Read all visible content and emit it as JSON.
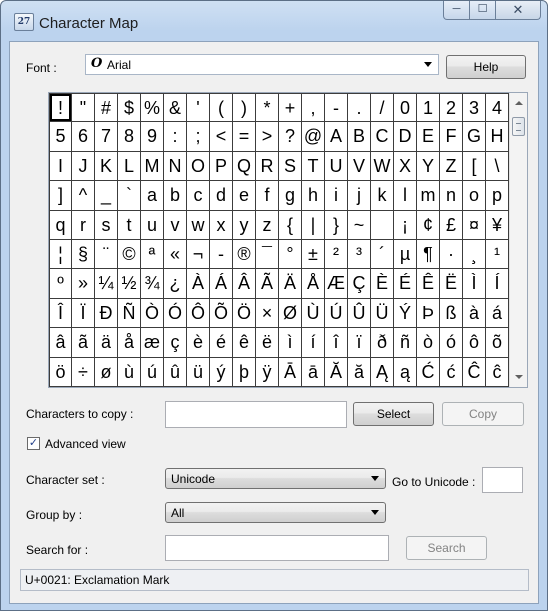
{
  "window": {
    "title": "Character Map",
    "app_icon_text": "27",
    "minimize_glyph": "─",
    "maximize_glyph": "☐",
    "close_glyph": "✕"
  },
  "font": {
    "label": "Font :",
    "icon_glyph": "O",
    "selected": "Arial",
    "help_label": "Help"
  },
  "grid": {
    "selected_index": 0,
    "chars": [
      "!",
      "\"",
      "#",
      "$",
      "%",
      "&",
      "'",
      "(",
      ")",
      "*",
      "+",
      ",",
      "-",
      ".",
      "/",
      "0",
      "1",
      "2",
      "3",
      "4",
      "5",
      "6",
      "7",
      "8",
      "9",
      ":",
      ";",
      "<",
      "=",
      ">",
      "?",
      "@",
      "A",
      "B",
      "C",
      "D",
      "E",
      "F",
      "G",
      "H",
      "I",
      "J",
      "K",
      "L",
      "M",
      "N",
      "O",
      "P",
      "Q",
      "R",
      "S",
      "T",
      "U",
      "V",
      "W",
      "X",
      "Y",
      "Z",
      "[",
      "\\",
      "]",
      "^",
      "_",
      "`",
      "a",
      "b",
      "c",
      "d",
      "e",
      "f",
      "g",
      "h",
      "i",
      "j",
      "k",
      "l",
      "m",
      "n",
      "o",
      "p",
      "q",
      "r",
      "s",
      "t",
      "u",
      "v",
      "w",
      "x",
      "y",
      "z",
      "{",
      "|",
      "}",
      "~",
      " ",
      "¡",
      "¢",
      "£",
      "¤",
      "¥",
      "¦",
      "§",
      "¨",
      "©",
      "ª",
      "«",
      "¬",
      "-",
      "®",
      "¯",
      "°",
      "±",
      "²",
      "³",
      "´",
      "µ",
      "¶",
      "·",
      "¸",
      "¹",
      "º",
      "»",
      "¼",
      "½",
      "¾",
      "¿",
      "À",
      "Á",
      "Â",
      "Ã",
      "Ä",
      "Å",
      "Æ",
      "Ç",
      "È",
      "É",
      "Ê",
      "Ë",
      "Ì",
      "Í",
      "Î",
      "Ï",
      "Ð",
      "Ñ",
      "Ò",
      "Ó",
      "Ô",
      "Õ",
      "Ö",
      "×",
      "Ø",
      "Ù",
      "Ú",
      "Û",
      "Ü",
      "Ý",
      "Þ",
      "ß",
      "à",
      "á",
      "â",
      "ã",
      "ä",
      "å",
      "æ",
      "ç",
      "è",
      "é",
      "ê",
      "ë",
      "ì",
      "í",
      "î",
      "ï",
      "ð",
      "ñ",
      "ò",
      "ó",
      "ô",
      "õ",
      "ö",
      "÷",
      "ø",
      "ù",
      "ú",
      "û",
      "ü",
      "ý",
      "þ",
      "ÿ",
      "Ā",
      "ā",
      "Ă",
      "ă",
      "Ą",
      "ą",
      "Ć",
      "ć",
      "Ĉ",
      "ĉ"
    ]
  },
  "copy": {
    "label": "Characters to copy :",
    "value": "",
    "select_label": "Select",
    "copy_label": "Copy"
  },
  "advanced": {
    "label": "Advanced view",
    "checked": true,
    "check_glyph": "✓"
  },
  "charset": {
    "label": "Character set :",
    "selected": "Unicode",
    "goto_label": "Go to Unicode :",
    "goto_value": ""
  },
  "groupby": {
    "label": "Group by :",
    "selected": "All"
  },
  "search": {
    "label": "Search for :",
    "value": "",
    "button_label": "Search"
  },
  "status": {
    "text": "U+0021: Exclamation Mark"
  }
}
